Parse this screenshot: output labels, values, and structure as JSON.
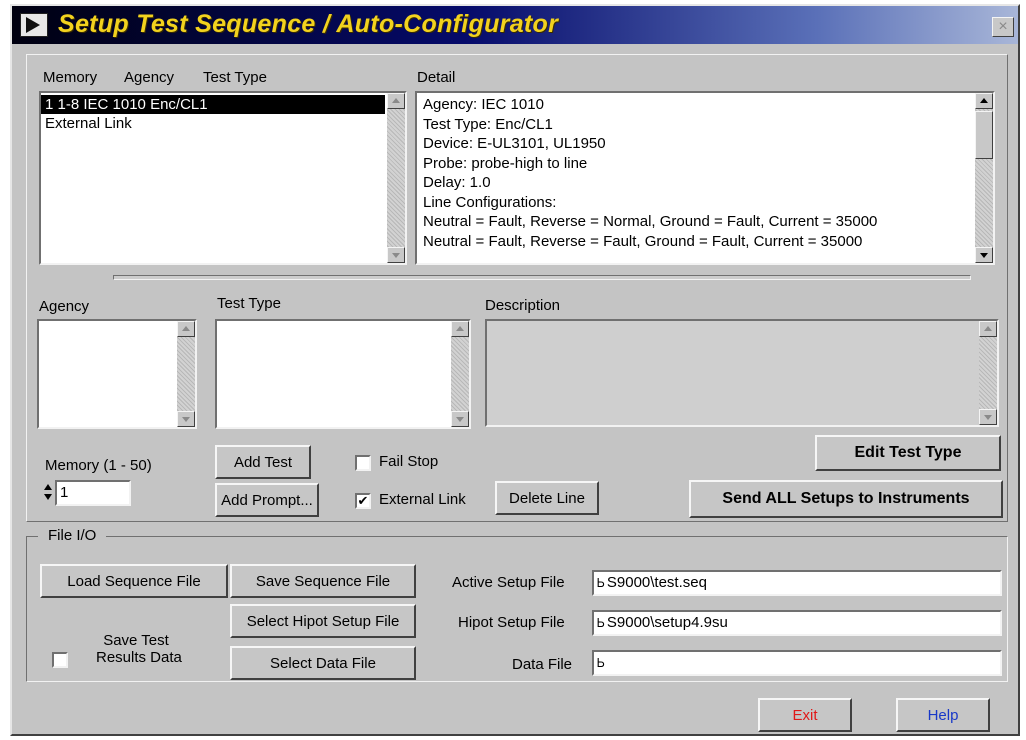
{
  "window": {
    "title": "Setup Test Sequence / Auto-Configurator",
    "close_glyph": "×"
  },
  "sequence_list": {
    "col_memory": "Memory",
    "col_agency": "Agency",
    "col_test_type": "Test Type",
    "rows": [
      "1 1-8   IEC 1010  Enc/CL1",
      "External Link"
    ],
    "selected_index": 0
  },
  "detail": {
    "label": "Detail",
    "lines": [
      "Agency:  IEC 1010",
      "Test Type:  Enc/CL1",
      "Device:  E-UL3101, UL1950",
      "Probe:  probe-high to line",
      "Delay:  1.0",
      "Line Configurations:",
      "Neutral = Fault, Reverse = Normal, Ground = Fault, Current =   35000",
      "Neutral = Fault, Reverse = Fault, Ground = Fault, Current =   35000"
    ]
  },
  "editor": {
    "agency_label": "Agency",
    "test_type_label": "Test Type",
    "description_label": "Description",
    "memory_label": "Memory (1 - 50)",
    "memory_value": "1",
    "add_test": "Add Test",
    "add_prompt": "Add Prompt...",
    "fail_stop": "Fail Stop",
    "fail_stop_checked": false,
    "external_link": "External Link",
    "external_link_checked": true,
    "delete_line": "Delete Line",
    "edit_test_type": "Edit Test Type",
    "send_all": "Send ALL Setups to Instruments"
  },
  "file_io": {
    "group_label": "File I/O",
    "load_sequence": "Load Sequence File",
    "save_sequence": "Save Sequence File",
    "select_hipot": "Select Hipot Setup File",
    "select_data": "Select Data File",
    "save_results_line1": "Save Test",
    "save_results_line2": "Results Data",
    "save_results_checked": false,
    "active_setup_label": "Active Setup File",
    "active_setup_value": "S9000\\test.seq",
    "hipot_setup_label": "Hipot Setup File",
    "hipot_setup_value": "S9000\\setup4.9su",
    "data_file_label": "Data File",
    "data_file_value": "",
    "path_glyph": "Ꮟ"
  },
  "footer": {
    "exit": "Exit",
    "help": "Help",
    "exit_color": "#e01818",
    "help_color": "#1838c8"
  },
  "colors": {
    "title_text": "#f2d21e",
    "title_bar": "#050a6a",
    "window_bg": "#c4c4c4"
  }
}
